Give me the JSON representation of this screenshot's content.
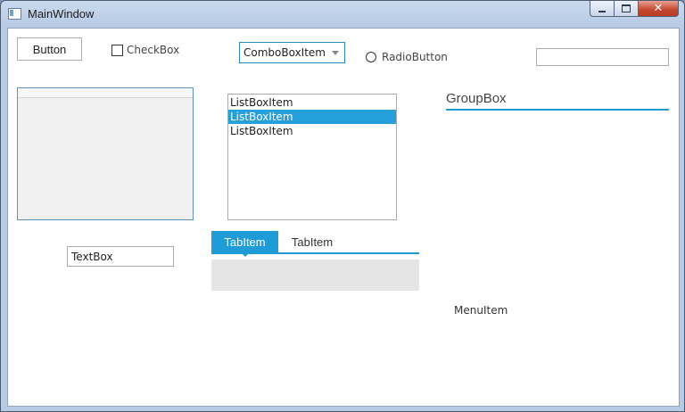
{
  "window": {
    "title": "MainWindow"
  },
  "controls": {
    "button_label": "Button",
    "checkbox_label": "CheckBox",
    "combobox_value": "ComboBoxItem",
    "radio_label": "RadioButton",
    "top_textbox_value": "",
    "listbox_items": [
      "ListBoxItem",
      "ListBoxItem",
      "ListBoxItem"
    ],
    "listbox_selected_index": 1,
    "groupbox_header": "GroupBox",
    "textbox_value": "TextBox",
    "tabs": [
      "TabItem",
      "TabItem"
    ],
    "active_tab_index": 0,
    "menu_item_label": "MenuItem"
  },
  "colors": {
    "accent": "#1e9cd8",
    "selection": "#26a0da",
    "close_button": "#c6452e"
  }
}
